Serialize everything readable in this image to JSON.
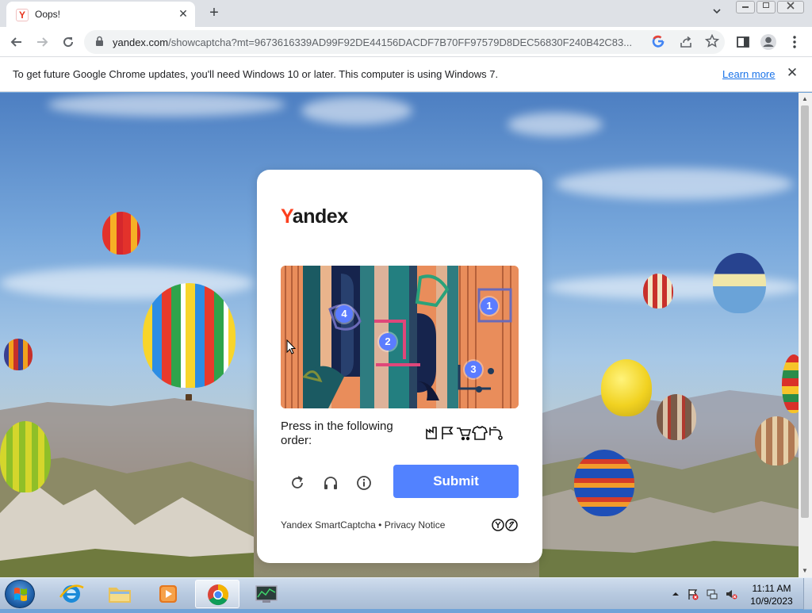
{
  "browser": {
    "tab_title": "Oops!",
    "favicon_letter": "Y",
    "url_host": "yandex.com",
    "url_path": "/showcaptcha?mt=9673616339AD99F92DE44156DACDF7B70FF97579D8DEC56830F240B42C83...",
    "close_glyph": "✕",
    "new_tab_glyph": "+"
  },
  "infobar": {
    "message": "To get future Google Chrome updates, you'll need Windows 10 or later. This computer is using Windows 7.",
    "link": "Learn more",
    "close_glyph": "✕"
  },
  "captcha": {
    "logo_first": "Y",
    "logo_rest": "andex",
    "markers": [
      "1",
      "2",
      "3",
      "4"
    ],
    "instruction": "Press in the following order:",
    "order_icons": [
      "factory-icon",
      "flag-icon",
      "cart-icon",
      "tshirt-icon",
      "faucet-icon"
    ],
    "submit_label": "Submit",
    "footer": "Yandex SmartCaptcha • Privacy Notice",
    "controls": [
      "refresh-icon",
      "headphones-icon",
      "info-icon"
    ]
  },
  "taskbar": {
    "time": "11:11 AM",
    "date": "10/9/2023",
    "apps": [
      "internet-explorer",
      "file-explorer",
      "media-player",
      "chrome",
      "task-manager"
    ]
  },
  "colors": {
    "accent": "#5282ff",
    "yandex_red": "#fc3f1d",
    "link": "#1a73e8"
  }
}
